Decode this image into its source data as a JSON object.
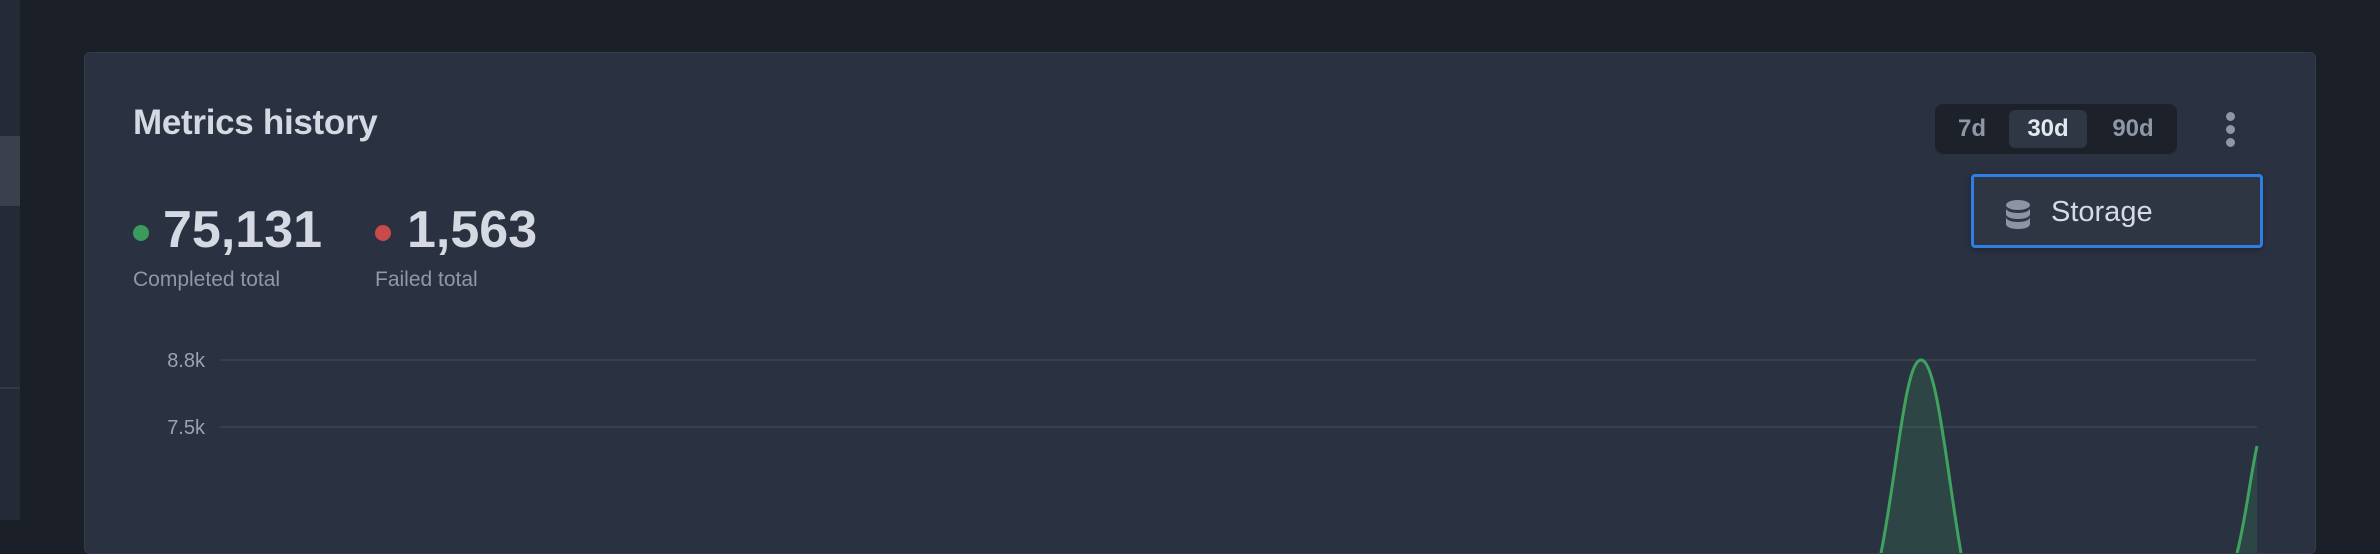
{
  "panel": {
    "title": "Metrics history"
  },
  "range_selector": {
    "options": [
      {
        "label": "7d",
        "active": false
      },
      {
        "label": "30d",
        "active": true
      },
      {
        "label": "90d",
        "active": false
      }
    ]
  },
  "menu": {
    "icon": "kebab-vertical-icon",
    "items": [
      {
        "label": "Storage",
        "icon": "database-icon",
        "focused": true
      }
    ]
  },
  "stats": {
    "completed": {
      "value": "75,131",
      "caption": "Completed total",
      "color": "#3a9b5c"
    },
    "failed": {
      "value": "1,563",
      "caption": "Failed total",
      "color": "#c94a4a"
    }
  },
  "colors": {
    "background": "#1b1f27",
    "panel": "#2a3140",
    "accent": "#2f7ee6",
    "series_line": "#3fa35f",
    "grid": "#33424c"
  },
  "chart_data": {
    "type": "area",
    "y_ticks": [
      "8.8k",
      "7.5k"
    ],
    "y_tick_values": [
      8800,
      7500
    ],
    "series": [
      {
        "values": [
          8800
        ]
      }
    ]
  }
}
